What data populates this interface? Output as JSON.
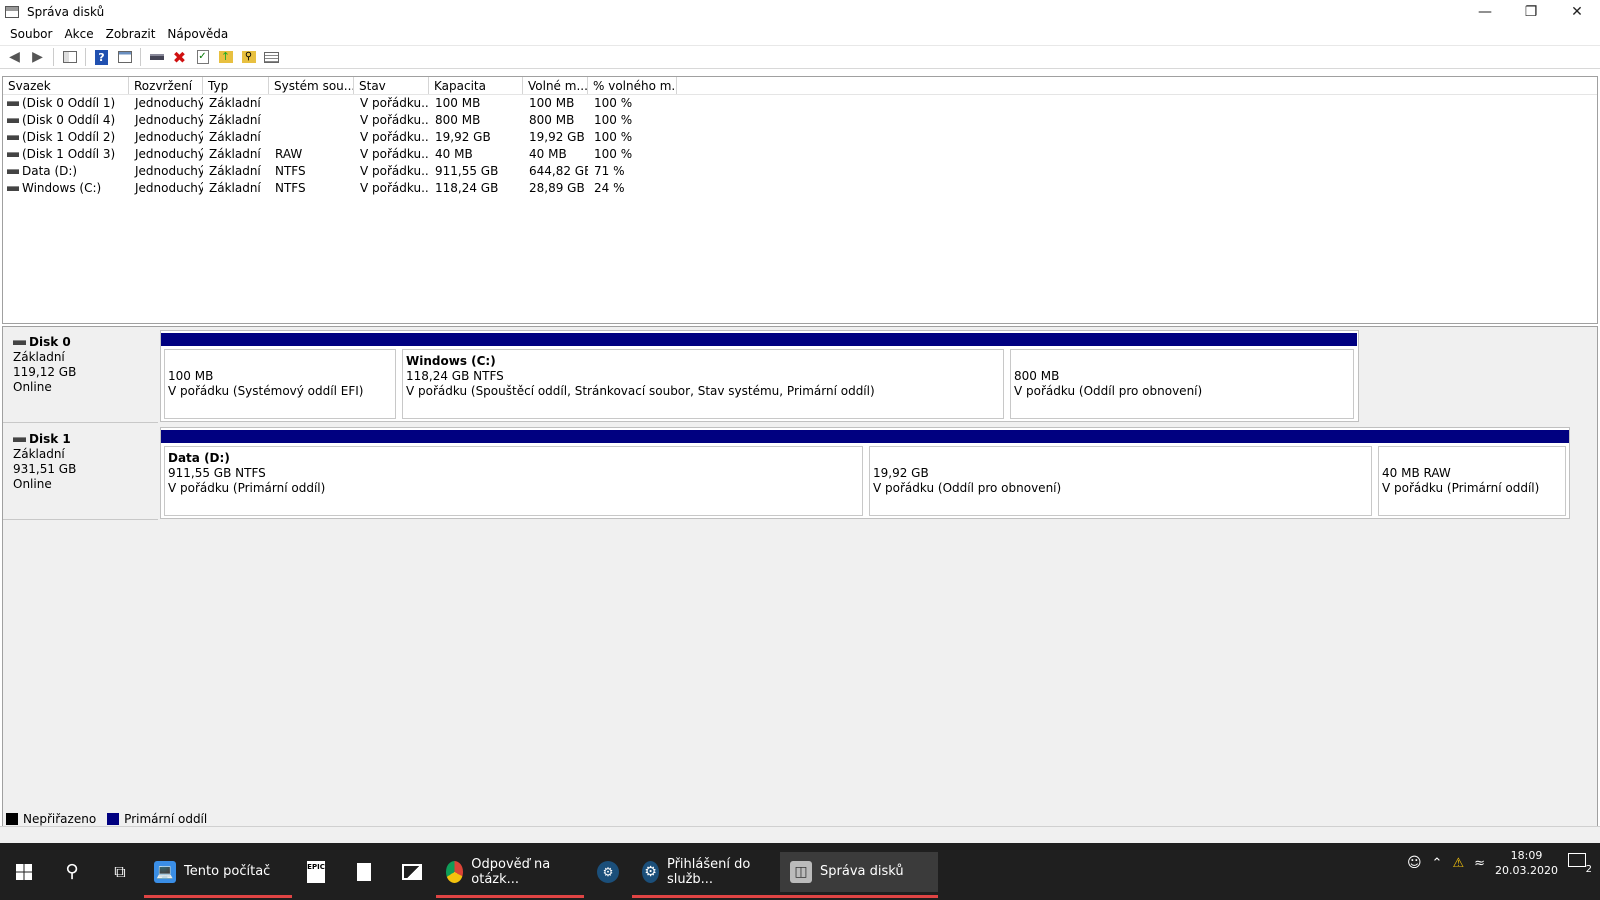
{
  "window": {
    "title": "Správa disků",
    "minimize_icon": "minimize-icon",
    "restore_icon": "restore-icon",
    "close_icon": "close-icon"
  },
  "menu": [
    "Soubor",
    "Akce",
    "Zobrazit",
    "Nápověda"
  ],
  "toolbar": {
    "icons": [
      "back-arrow-icon",
      "forward-arrow-icon",
      "show-hide-console-tree-icon",
      "help-icon",
      "properties-icon",
      "connect-drive-icon",
      "delete-icon",
      "check-icon",
      "folder-up-icon",
      "search-folder-icon",
      "view-icon"
    ]
  },
  "volumes": {
    "headers": [
      "Svazek",
      "Rozvržení",
      "Typ",
      "Systém sou...",
      "Stav",
      "Kapacita",
      "Volné m...",
      "% volného m..."
    ],
    "rows": [
      [
        "(Disk 0 Oddíl 1)",
        "Jednoduchý",
        "Základní",
        "",
        "V pořádku...",
        "100 MB",
        "100 MB",
        "100 %"
      ],
      [
        "(Disk 0 Oddíl 4)",
        "Jednoduchý",
        "Základní",
        "",
        "V pořádku...",
        "800 MB",
        "800 MB",
        "100 %"
      ],
      [
        "(Disk 1 Oddíl 2)",
        "Jednoduchý",
        "Základní",
        "",
        "V pořádku...",
        "19,92 GB",
        "19,92 GB",
        "100 %"
      ],
      [
        "(Disk 1 Oddíl 3)",
        "Jednoduchý",
        "Základní",
        "RAW",
        "V pořádku...",
        "40 MB",
        "40 MB",
        "100 %"
      ],
      [
        "Data (D:)",
        "Jednoduchý",
        "Základní",
        "NTFS",
        "V pořádku...",
        "911,55 GB",
        "644,82 GB",
        "71 %"
      ],
      [
        "Windows (C:)",
        "Jednoduchý",
        "Základní",
        "NTFS",
        "V pořádku...",
        "118,24 GB",
        "28,89 GB",
        "24 %"
      ]
    ]
  },
  "disks": [
    {
      "name": "Disk 0",
      "type": "Základní",
      "size": "119,12 GB",
      "status": "Online",
      "partitions": [
        {
          "name": "",
          "size": "100 MB",
          "status": "V pořádku (Systémový oddíl EFI)"
        },
        {
          "name": "Windows  (C:)",
          "size": "118,24 GB NTFS",
          "status": "V pořádku (Spouštěcí oddíl, Stránkovací soubor, Stav systému, Primární oddíl)"
        },
        {
          "name": "",
          "size": "800 MB",
          "status": "V pořádku (Oddíl pro obnovení)"
        }
      ]
    },
    {
      "name": "Disk 1",
      "type": "Základní",
      "size": "931,51 GB",
      "status": "Online",
      "partitions": [
        {
          "name": "Data  (D:)",
          "size": "911,55 GB NTFS",
          "status": "V pořádku (Primární oddíl)"
        },
        {
          "name": "",
          "size": "19,92 GB",
          "status": "V pořádku (Oddíl pro obnovení)"
        },
        {
          "name": "",
          "size": "40 MB RAW",
          "status": "V pořádku (Primární oddíl)"
        }
      ]
    }
  ],
  "legend": [
    {
      "label": "Nepřiřazeno",
      "color": "#000000"
    },
    {
      "label": "Primární oddíl",
      "color": "#000080"
    }
  ],
  "taskbar": {
    "apps": [
      {
        "label": "Tento počítač",
        "icon": "this-pc-icon",
        "active": false
      },
      {
        "label": "Odpověď na otázk...",
        "icon": "chrome-icon",
        "active": false
      },
      {
        "label": "Přihlášení do služb...",
        "icon": "steam-icon",
        "active": false
      },
      {
        "label": "Správa disků",
        "icon": "disk-management-icon",
        "active": true
      }
    ],
    "time": "18:09",
    "date": "20.03.2020",
    "notification_count": "2"
  }
}
